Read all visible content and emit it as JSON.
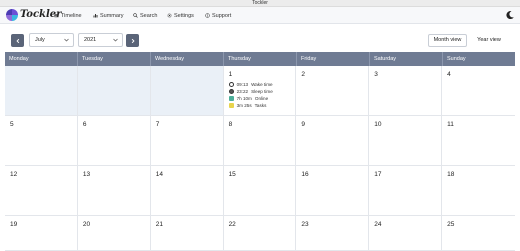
{
  "window": {
    "title": "Tockler"
  },
  "app": {
    "brand": "Tockler"
  },
  "nav": {
    "items": [
      {
        "label": "Timeline",
        "icon": "timeline-icon"
      },
      {
        "label": "Summary",
        "icon": "summary-icon"
      },
      {
        "label": "Search",
        "icon": "search-icon"
      },
      {
        "label": "Settings",
        "icon": "settings-icon"
      },
      {
        "label": "Support",
        "icon": "support-icon"
      }
    ],
    "theme_icon": "moon-icon"
  },
  "controls": {
    "month": "July",
    "year": "2021",
    "month_view_label": "Month view",
    "year_view_label": "Year view",
    "active_view": "Month view"
  },
  "calendar": {
    "weekdays": [
      "Monday",
      "Tuesday",
      "Wednesday",
      "Thursday",
      "Friday",
      "Saturday",
      "Sunday"
    ],
    "weeks": [
      [
        "",
        "",
        "",
        "1",
        "2",
        "3",
        "4"
      ],
      [
        "5",
        "6",
        "7",
        "8",
        "9",
        "10",
        "11"
      ],
      [
        "12",
        "13",
        "14",
        "15",
        "16",
        "17",
        "18"
      ],
      [
        "19",
        "20",
        "21",
        "22",
        "23",
        "24",
        "25"
      ]
    ],
    "day1_stats": [
      {
        "value": "09:13",
        "label": "Wake time",
        "icon": "clock-outline-icon"
      },
      {
        "value": "23:22",
        "label": "Sleep time",
        "icon": "clock-filled-icon"
      },
      {
        "value": "7h 10m",
        "label": "Online",
        "icon": "online-swatch",
        "color": "#4caf9a"
      },
      {
        "value": "3m 25s",
        "label": "Tasks",
        "icon": "tasks-swatch",
        "color": "#e8d44d"
      }
    ]
  },
  "colors": {
    "header_bg": "#6f7b93",
    "nav_button_bg": "#5a6478",
    "empty_cell_bg": "#eaf0f7"
  }
}
